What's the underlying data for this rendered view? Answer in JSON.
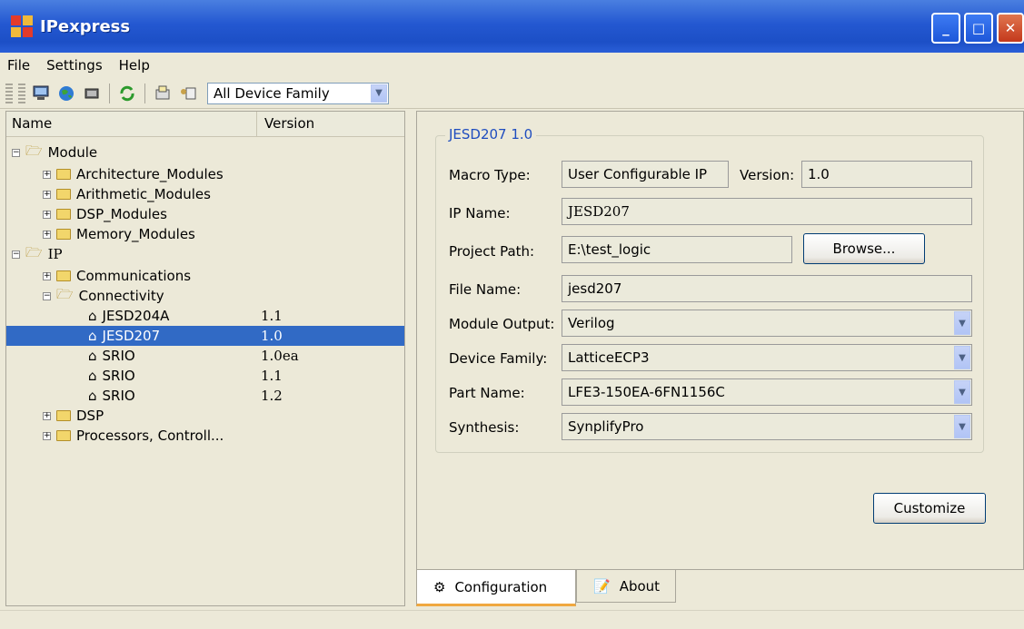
{
  "window": {
    "title": "IPexpress",
    "minimize": "_",
    "maximize": "□",
    "close": "✕"
  },
  "menu": [
    "File",
    "Settings",
    "Help"
  ],
  "toolbar": {
    "family_select": "All Device Family"
  },
  "tree": {
    "col_name": "Name",
    "col_version": "Version",
    "rows": [
      {
        "label": "Module",
        "version": ""
      },
      {
        "label": "Architecture_Modules",
        "version": ""
      },
      {
        "label": "Arithmetic_Modules",
        "version": ""
      },
      {
        "label": "DSP_Modules",
        "version": ""
      },
      {
        "label": "Memory_Modules",
        "version": ""
      },
      {
        "label": "IP",
        "version": ""
      },
      {
        "label": "Communications",
        "version": ""
      },
      {
        "label": "Connectivity",
        "version": ""
      },
      {
        "label": "JESD204A",
        "version": "1.1"
      },
      {
        "label": "JESD207",
        "version": "1.0"
      },
      {
        "label": "SRIO",
        "version": "1.0ea"
      },
      {
        "label": "SRIO",
        "version": "1.1"
      },
      {
        "label": "SRIO",
        "version": "1.2"
      },
      {
        "label": "DSP",
        "version": ""
      },
      {
        "label": "Processors, Controll...",
        "version": ""
      }
    ]
  },
  "config": {
    "group_title": "JESD207 1.0",
    "macro_type_label": "Macro Type:",
    "macro_type_value": "User Configurable IP",
    "version_label": "Version:",
    "version_value": "1.0",
    "ip_name_label": "IP Name:",
    "ip_name_value": "JESD207",
    "project_path_label": "Project Path:",
    "project_path_value": "E:\\test_logic",
    "browse_button": "Browse...",
    "file_name_label": "File Name:",
    "file_name_value": "jesd207",
    "module_output_label": "Module Output:",
    "module_output_value": "Verilog",
    "device_family_label": "Device Family:",
    "device_family_value": "LatticeECP3",
    "part_name_label": "Part Name:",
    "part_name_value": "LFE3-150EA-6FN1156C",
    "synthesis_label": "Synthesis:",
    "synthesis_value": "SynplifyPro",
    "customize_button": "Customize"
  },
  "tabs": [
    "Configuration",
    "About"
  ]
}
